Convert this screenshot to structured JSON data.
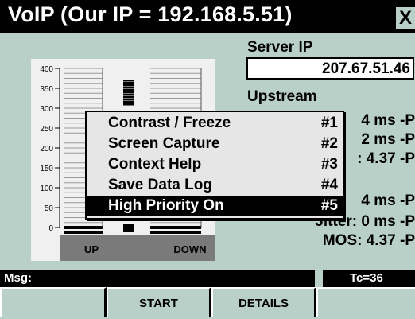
{
  "window": {
    "title": "VoIP  (Our IP = 192.168.5.51)",
    "close_glyph": "X"
  },
  "server": {
    "label": "Server IP",
    "ip": "207.67.51.46"
  },
  "upstream": {
    "label": "Upstream",
    "jitter_partial": "4 ms -P",
    "mos_partial_1": "2 ms -P",
    "mos_partial_2": ": 4.37 -P"
  },
  "downstream": {
    "delay_partial": "4 ms -P",
    "jitter_partial": "Jitter: 0 ms -P",
    "mos": "MOS: 4.37 -P"
  },
  "chart_data": {
    "type": "bar",
    "y_ticks": [
      "400",
      "350",
      "300",
      "250",
      "200",
      "150",
      "100",
      "50",
      "0"
    ],
    "ylim": [
      0,
      400
    ],
    "categories": [
      "UP",
      "DOWN"
    ],
    "values": [
      0,
      0
    ],
    "center_meter_level": 400
  },
  "context_menu": {
    "items": [
      {
        "label": "Contrast / Freeze",
        "key": "#1",
        "selected": false
      },
      {
        "label": "Screen Capture",
        "key": "#2",
        "selected": false
      },
      {
        "label": "Context Help",
        "key": "#3",
        "selected": false
      },
      {
        "label": "Save Data Log",
        "key": "#4",
        "selected": false
      },
      {
        "label": "High Priority On",
        "key": "#5",
        "selected": true
      }
    ]
  },
  "status": {
    "msg_label": "Msg:",
    "tc": "Tc=36"
  },
  "softkeys": [
    "",
    "START",
    "DETAILS",
    ""
  ],
  "colors": {
    "background": "#b9d0c8",
    "menu_selected": "#000000",
    "chart_bg": "#f0f0f0"
  }
}
